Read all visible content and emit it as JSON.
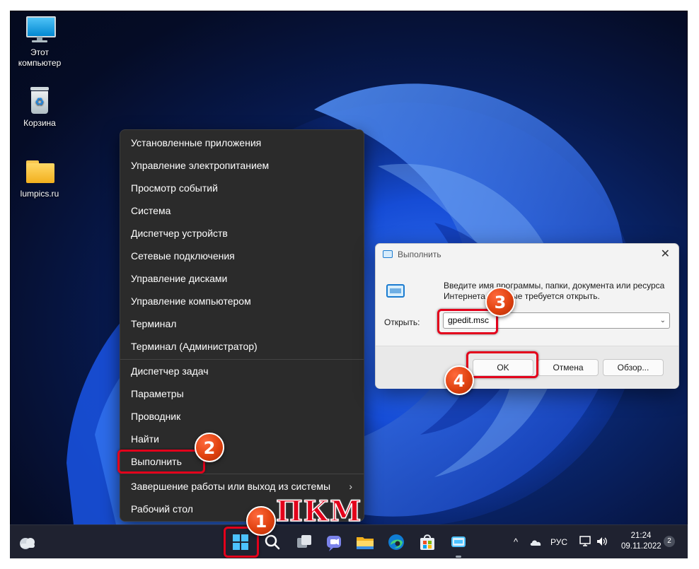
{
  "desktop": {
    "icons": [
      {
        "label": "Этот компьютер",
        "icon": "monitor-icon"
      },
      {
        "label": "Корзина",
        "icon": "recycle-bin-icon"
      },
      {
        "label": "lumpics.ru",
        "icon": "folder-icon"
      }
    ]
  },
  "context_menu": {
    "items": [
      "Установленные приложения",
      "Управление электропитанием",
      "Просмотр событий",
      "Система",
      "Диспетчер устройств",
      "Сетевые подключения",
      "Управление дисками",
      "Управление компьютером",
      "Терминал",
      "Терминал (Администратор)",
      "Диспетчер задач",
      "Параметры",
      "Проводник",
      "Найти",
      "Выполнить",
      "Завершение работы или выход из системы",
      "Рабочий стол"
    ],
    "submenu_chevron": "›"
  },
  "run_dialog": {
    "title": "Выполнить",
    "close_glyph": "✕",
    "description": "Введите имя программы, папки, документа или ресурса Интернета, которые требуется открыть.",
    "open_label": "Открыть:",
    "input_value": "gpedit.msc",
    "dropdown_glyph": "⌄",
    "ok_label": "OK",
    "cancel_label": "Отмена",
    "browse_label": "Обзор..."
  },
  "taskbar": {
    "apps": [
      "start-icon",
      "search-icon",
      "task-view-icon",
      "teams-chat-icon",
      "file-explorer-icon",
      "edge-icon",
      "store-icon",
      "run-app-icon"
    ],
    "tray": {
      "chevron": "^",
      "language": "РУС",
      "time": "21:24",
      "date": "09.11.2022",
      "notifications": "2"
    }
  },
  "annotations": {
    "steps": [
      "1",
      "2",
      "3",
      "4"
    ],
    "right_click_label": "ПКМ",
    "highlight_color": "#e3001b",
    "badge_color": "#e04210"
  }
}
